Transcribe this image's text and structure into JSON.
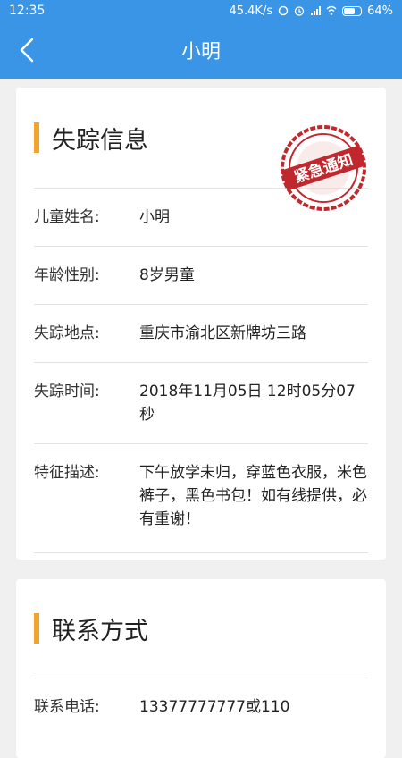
{
  "status_bar": {
    "time": "12:35",
    "network_speed": "45.4K/s",
    "battery": "64%"
  },
  "nav": {
    "title": "小明"
  },
  "missing_section": {
    "title": "失踪信息",
    "stamp_text": "紧急通知",
    "rows": [
      {
        "label": "儿童姓名:",
        "value": "小明"
      },
      {
        "label": "年龄性别:",
        "value": "8岁男童"
      },
      {
        "label": "失踪地点:",
        "value": "重庆市渝北区新牌坊三路"
      },
      {
        "label": "失踪时间:",
        "value": "2018年11月05日 12时05分07秒"
      },
      {
        "label": "特征描述:",
        "value": "下午放学未归，穿蓝色衣服，米色裤子，黑色书包！如有线提供，必有重谢！"
      }
    ]
  },
  "contact_section": {
    "title": "联系方式",
    "rows": [
      {
        "label": "联系电话:",
        "value": "13377777777或110"
      }
    ]
  },
  "colors": {
    "primary": "#3a95e6",
    "accent_bar": "#f2a42b",
    "stamp": "#c0282e"
  }
}
